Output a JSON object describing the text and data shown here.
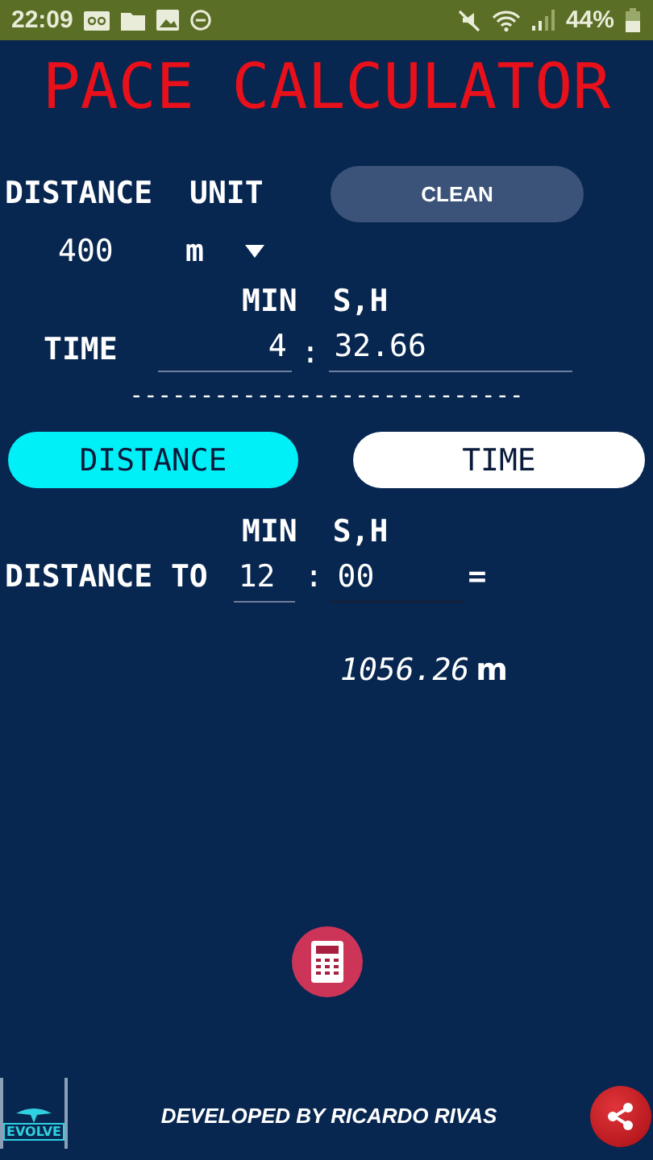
{
  "status_bar": {
    "time": "22:09",
    "battery": "44%"
  },
  "title": "PACE CALCULATOR",
  "distance": {
    "label": "DISTANCE",
    "value": "400"
  },
  "unit": {
    "label": "UNIT",
    "value": "m"
  },
  "clean_button": "CLEAN",
  "time": {
    "label": "TIME",
    "min_label": "MIN",
    "sec_label": "S,H",
    "minutes": "4",
    "separator": ":",
    "seconds": "32.66"
  },
  "divider": "----------------------------",
  "modes": [
    {
      "label": "DISTANCE",
      "selected": true
    },
    {
      "label": "TIME",
      "selected": false
    }
  ],
  "query": {
    "label": "DISTANCE TO",
    "min_label": "MIN",
    "sec_label": "S,H",
    "minutes": "12",
    "separator": ":",
    "seconds": "00",
    "equals": "="
  },
  "result": {
    "value": "1056.26",
    "unit": "m"
  },
  "footer": {
    "logo": "EVOLVE",
    "credit": "DEVELOPED BY RICARDO RIVAS"
  }
}
